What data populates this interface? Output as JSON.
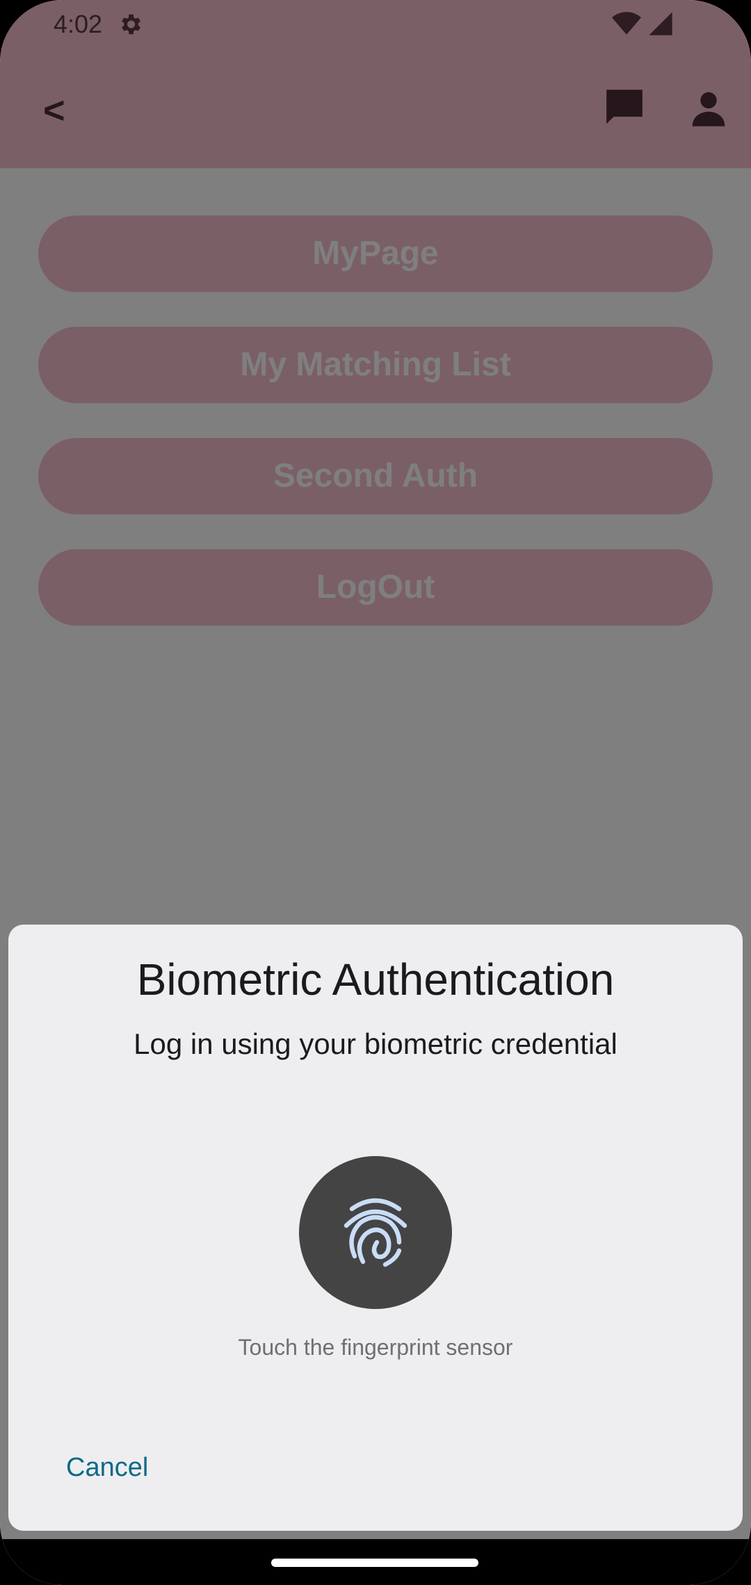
{
  "status_bar": {
    "time": "4:02"
  },
  "appbar": {
    "back_label": "<"
  },
  "menu": {
    "items": [
      "MyPage",
      "My Matching List",
      "Second Auth",
      "LogOut"
    ]
  },
  "dialog": {
    "title": "Biometric Authentication",
    "subtitle": "Log in using your biometric credential",
    "hint": "Touch the fingerprint sensor",
    "cancel_label": "Cancel"
  },
  "colors": {
    "appbar": "#F7BECD",
    "button": "#F7BECD",
    "dialog_bg": "#EEEEF0",
    "fingerprint_circle": "#444444",
    "accent": "#0B6A86"
  },
  "icons": [
    "gear-icon",
    "wifi-icon",
    "signal-icon",
    "chat-icon",
    "person-icon",
    "fingerprint-icon"
  ]
}
